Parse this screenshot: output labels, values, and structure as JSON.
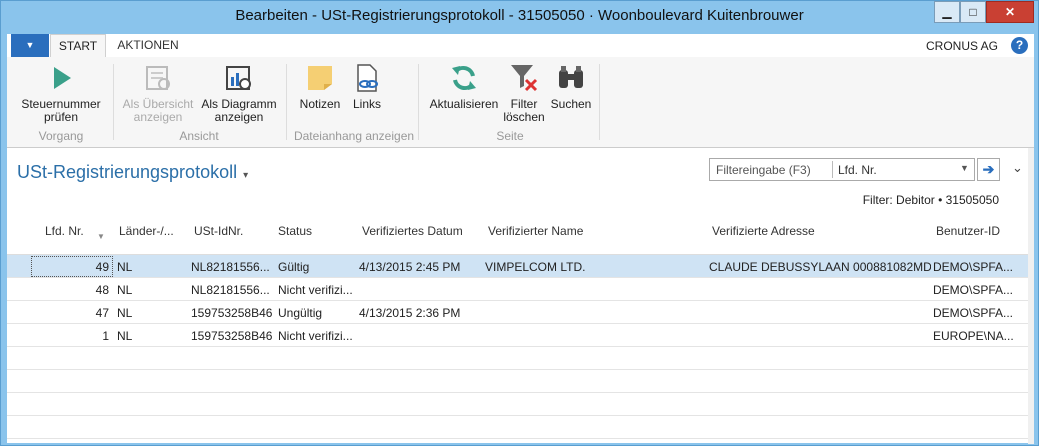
{
  "window": {
    "title": "Bearbeiten - USt-Registrierungsprotokoll - 31505050 · Woonboulevard Kuitenbrouwer",
    "min_glyph": "▁",
    "max_glyph": "□",
    "close_glyph": "✕"
  },
  "ribbon": {
    "app_menu_glyph": "▼",
    "tabs": {
      "start": "START",
      "aktionen": "AKTIONEN"
    },
    "company": "CRONUS AG",
    "help_glyph": "?",
    "buttons": {
      "steuernummer": "Steuernummer\nprüfen",
      "uebersicht": "Als Übersicht\nanzeigen",
      "diagramm": "Als Diagramm\nanzeigen",
      "notizen": "Notizen",
      "links": "Links",
      "aktualisieren": "Aktualisieren",
      "filter": "Filter\nlöschen",
      "suchen": "Suchen"
    },
    "groups": {
      "vorgang": "Vorgang",
      "ansicht": "Ansicht",
      "dateianhang": "Dateianhang anzeigen",
      "seite": "Seite"
    }
  },
  "page": {
    "title": "USt-Registrierungsprotokoll",
    "title_caret": "▾",
    "filter_placeholder": "Filtereingabe (F3)",
    "filter_field": "Lfd. Nr.",
    "filter_dd": "▼",
    "go_glyph": "➔",
    "expand_glyph": "⌄",
    "filter_info": "Filter: Debitor • 31505050"
  },
  "grid": {
    "columns": {
      "lfd": "Lfd. Nr.",
      "laender": "Länder-/...",
      "ustid": "USt-IdNr.",
      "status": "Status",
      "datum": "Verifiziertes Datum",
      "name": "Verifizierter Name",
      "adresse": "Verifizierte Adresse",
      "benutzer": "Benutzer-ID"
    },
    "sort_glyph": "▼",
    "rows": [
      {
        "lfd": "49",
        "land": "NL",
        "ustid": "NL82181556...",
        "status": "Gültig",
        "datum": "4/13/2015 2:45 PM",
        "name": "VIMPELCOM LTD.",
        "adresse": "CLAUDE DEBUSSYLAAN 000881082MD ...",
        "benutzer": "DEMO\\SPFA..."
      },
      {
        "lfd": "48",
        "land": "NL",
        "ustid": "NL82181556...",
        "status": "Nicht verifizi...",
        "datum": "",
        "name": "",
        "adresse": "",
        "benutzer": "DEMO\\SPFA..."
      },
      {
        "lfd": "47",
        "land": "NL",
        "ustid": "159753258B46",
        "status": "Ungültig",
        "datum": "4/13/2015 2:36 PM",
        "name": "",
        "adresse": "",
        "benutzer": "DEMO\\SPFA..."
      },
      {
        "lfd": "1",
        "land": "NL",
        "ustid": "159753258B46",
        "status": "Nicht verifizi...",
        "datum": "",
        "name": "",
        "adresse": "",
        "benutzer": "EUROPE\\NA..."
      }
    ]
  },
  "colors": {
    "accent": "#2a6ebd",
    "title_blue": "#2b6fa8",
    "selected_row": "#cfe3f4",
    "close_red": "#c94033"
  }
}
